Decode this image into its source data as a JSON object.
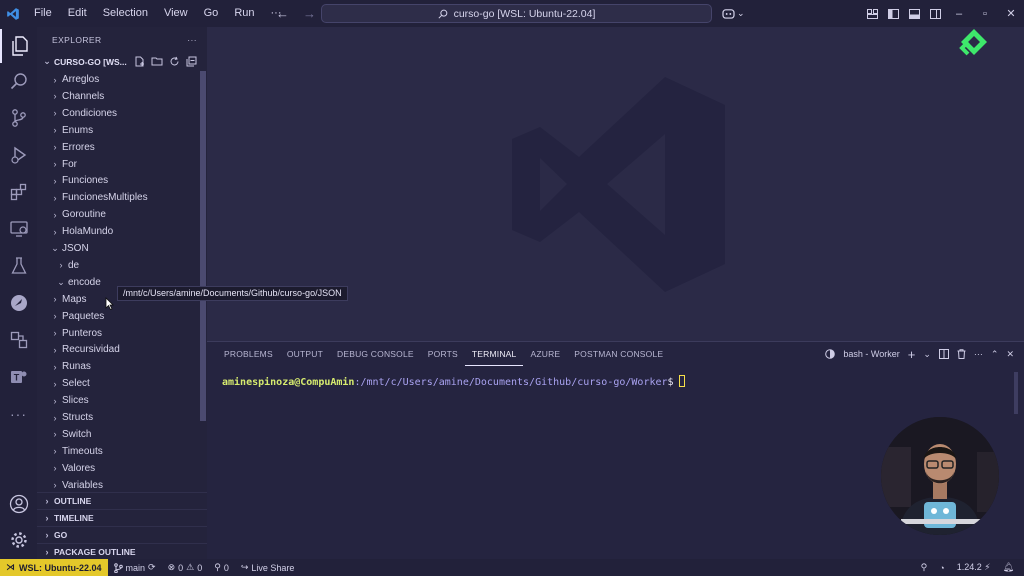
{
  "titlebar": {
    "menu": [
      "File",
      "Edit",
      "Selection",
      "View",
      "Go",
      "Run",
      "···"
    ],
    "search_text": "curso-go [WSL: Ubuntu-22.04]"
  },
  "explorer": {
    "header": "EXPLORER",
    "more": "···",
    "root": "CURSO-GO [WS...",
    "items": [
      {
        "label": "Arreglos",
        "state": "collapsed"
      },
      {
        "label": "Channels",
        "state": "collapsed"
      },
      {
        "label": "Condiciones",
        "state": "collapsed"
      },
      {
        "label": "Enums",
        "state": "collapsed"
      },
      {
        "label": "Errores",
        "state": "collapsed"
      },
      {
        "label": "For",
        "state": "collapsed"
      },
      {
        "label": "Funciones",
        "state": "collapsed"
      },
      {
        "label": "FuncionesMultiples",
        "state": "collapsed"
      },
      {
        "label": "Goroutine",
        "state": "collapsed"
      },
      {
        "label": "HolaMundo",
        "state": "collapsed"
      },
      {
        "label": "JSON",
        "state": "expanded"
      },
      {
        "label": "de",
        "state": "collapsed",
        "child": true
      },
      {
        "label": "encode",
        "state": "expanded",
        "child": true
      },
      {
        "label": "Maps",
        "state": "collapsed"
      },
      {
        "label": "Paquetes",
        "state": "collapsed"
      },
      {
        "label": "Punteros",
        "state": "collapsed"
      },
      {
        "label": "Recursividad",
        "state": "collapsed"
      },
      {
        "label": "Runas",
        "state": "collapsed"
      },
      {
        "label": "Select",
        "state": "collapsed"
      },
      {
        "label": "Slices",
        "state": "collapsed"
      },
      {
        "label": "Structs",
        "state": "collapsed"
      },
      {
        "label": "Switch",
        "state": "collapsed"
      },
      {
        "label": "Timeouts",
        "state": "collapsed"
      },
      {
        "label": "Valores",
        "state": "collapsed"
      },
      {
        "label": "Variables",
        "state": "collapsed"
      }
    ],
    "tooltip": "/mnt/c/Users/amine/Documents/Github/curso-go/JSON",
    "sections": [
      "OUTLINE",
      "TIMELINE",
      "GO",
      "PACKAGE OUTLINE"
    ]
  },
  "panel": {
    "tabs": [
      "PROBLEMS",
      "OUTPUT",
      "DEBUG CONSOLE",
      "PORTS",
      "TERMINAL",
      "AZURE",
      "POSTMAN CONSOLE"
    ],
    "active_tab": "TERMINAL",
    "terminal_name": "bash - Worker",
    "prompt_user": "aminespinoza@CompuAmin",
    "prompt_path": ":/mnt/c/Users/amine/Documents/Github/curso-go/Worker",
    "prompt_sign": "$"
  },
  "statusbar": {
    "remote": "WSL: Ubuntu-22.04",
    "branch": "main",
    "errors": "0",
    "warnings": "0",
    "ports": "0",
    "live_share": "Live Share",
    "go_version": "1.24.2"
  },
  "colors": {
    "accent_remote": "#e4c82a",
    "brand_green": "#3ee86b",
    "prompt_user": "#d7ec6f",
    "prompt_path": "#a9a2f0"
  }
}
